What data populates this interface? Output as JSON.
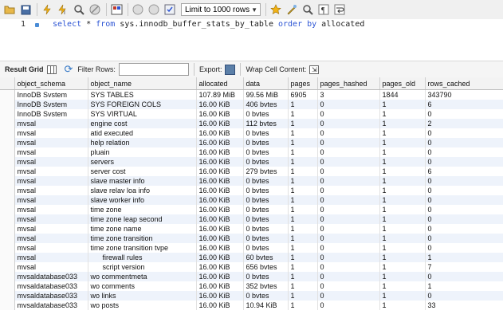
{
  "toolbar": {
    "limit_label": "Limit to 1000 rows",
    "icons": [
      "open-folder-icon",
      "save-icon",
      "execute-icon",
      "execute-current-icon",
      "explain-icon",
      "stop-icon",
      "toggle-output-icon",
      "commit-icon",
      "rollback-icon",
      "autocommit-icon",
      "limit-dropdown",
      "bookmark-icon",
      "beautify-icon",
      "find-icon",
      "invisible-chars-icon",
      "wrap-icon"
    ]
  },
  "editor": {
    "line_number": "1",
    "query": {
      "kw1": "select",
      "t1": " * ",
      "kw2": "from",
      "t2": " sys.innodb_buffer_stats_by_table ",
      "kw3": "order by",
      "t3": " allocated"
    }
  },
  "result_bar": {
    "result_grid_label": "Result Grid",
    "filter_rows_label": "Filter Rows:",
    "export_label": "Export:",
    "wrap_label": "Wrap Cell Content:"
  },
  "grid": {
    "columns": [
      "object_schema",
      "object_name",
      "allocated",
      "data",
      "pages",
      "pages_hashed",
      "pages_old",
      "rows_cached"
    ],
    "rows": [
      [
        "InnoDB Svstem",
        "SYS TABLES",
        "107.89 MiB",
        "99.56 MiB",
        "6905",
        "3",
        "1844",
        "343790"
      ],
      [
        "InnoDB Svstem",
        "SYS FOREIGN COLS",
        "16.00 KiB",
        "406 bvtes",
        "1",
        "0",
        "1",
        "6"
      ],
      [
        "InnoDB Svstem",
        "SYS VIRTUAL",
        "16.00 KiB",
        "0 bvtes",
        "1",
        "0",
        "1",
        "0"
      ],
      [
        "mvsal",
        "engine cost",
        "16.00 KiB",
        "112 bvtes",
        "1",
        "0",
        "1",
        "2"
      ],
      [
        "mvsal",
        "atid executed",
        "16.00 KiB",
        "0 bvtes",
        "1",
        "0",
        "1",
        "0"
      ],
      [
        "mvsal",
        "help relation",
        "16.00 KiB",
        "0 bvtes",
        "1",
        "0",
        "1",
        "0"
      ],
      [
        "mvsal",
        "pluain",
        "16.00 KiB",
        "0 bvtes",
        "1",
        "0",
        "1",
        "0"
      ],
      [
        "mvsal",
        "servers",
        "16.00 KiB",
        "0 bvtes",
        "1",
        "0",
        "1",
        "0"
      ],
      [
        "mvsal",
        "server cost",
        "16.00 KiB",
        "279 bvtes",
        "1",
        "0",
        "1",
        "6"
      ],
      [
        "mvsal",
        "slave master info",
        "16.00 KiB",
        "0 bvtes",
        "1",
        "0",
        "1",
        "0"
      ],
      [
        "mvsal",
        "slave relav loa info",
        "16.00 KiB",
        "0 bvtes",
        "1",
        "0",
        "1",
        "0"
      ],
      [
        "mvsal",
        "slave worker info",
        "16.00 KiB",
        "0 bvtes",
        "1",
        "0",
        "1",
        "0"
      ],
      [
        "mvsal",
        "time zone",
        "16.00 KiB",
        "0 bvtes",
        "1",
        "0",
        "1",
        "0"
      ],
      [
        "mvsal",
        "time zone leap second",
        "16.00 KiB",
        "0 bvtes",
        "1",
        "0",
        "1",
        "0"
      ],
      [
        "mvsal",
        "time zone name",
        "16.00 KiB",
        "0 bvtes",
        "1",
        "0",
        "1",
        "0"
      ],
      [
        "mvsal",
        "time zone transition",
        "16.00 KiB",
        "0 bvtes",
        "1",
        "0",
        "1",
        "0"
      ],
      [
        "mvsal",
        "time zone transition tvpe",
        "16.00 KiB",
        "0 bvtes",
        "1",
        "0",
        "1",
        "0"
      ],
      [
        "mvsal",
        "firewall rules",
        "16.00 KiB",
        "60 bvtes",
        "1",
        "0",
        "1",
        "1"
      ],
      [
        "mvsal",
        "script version",
        "16.00 KiB",
        "656 bvtes",
        "1",
        "0",
        "1",
        "7"
      ],
      [
        "mvsaldatabase033",
        "wo commentmeta",
        "16.00 KiB",
        "0 bvtes",
        "1",
        "0",
        "1",
        "0"
      ],
      [
        "mvsaldatabase033",
        "wo comments",
        "16.00 KiB",
        "352 bvtes",
        "1",
        "0",
        "1",
        "1"
      ],
      [
        "mvsaldatabase033",
        "wo links",
        "16.00 KiB",
        "0 bvtes",
        "1",
        "0",
        "1",
        "0"
      ],
      [
        "mvsaldatabase033",
        "wo posts",
        "16.00 KiB",
        "10.94 KiB",
        "1",
        "0",
        "1",
        "33"
      ]
    ]
  }
}
